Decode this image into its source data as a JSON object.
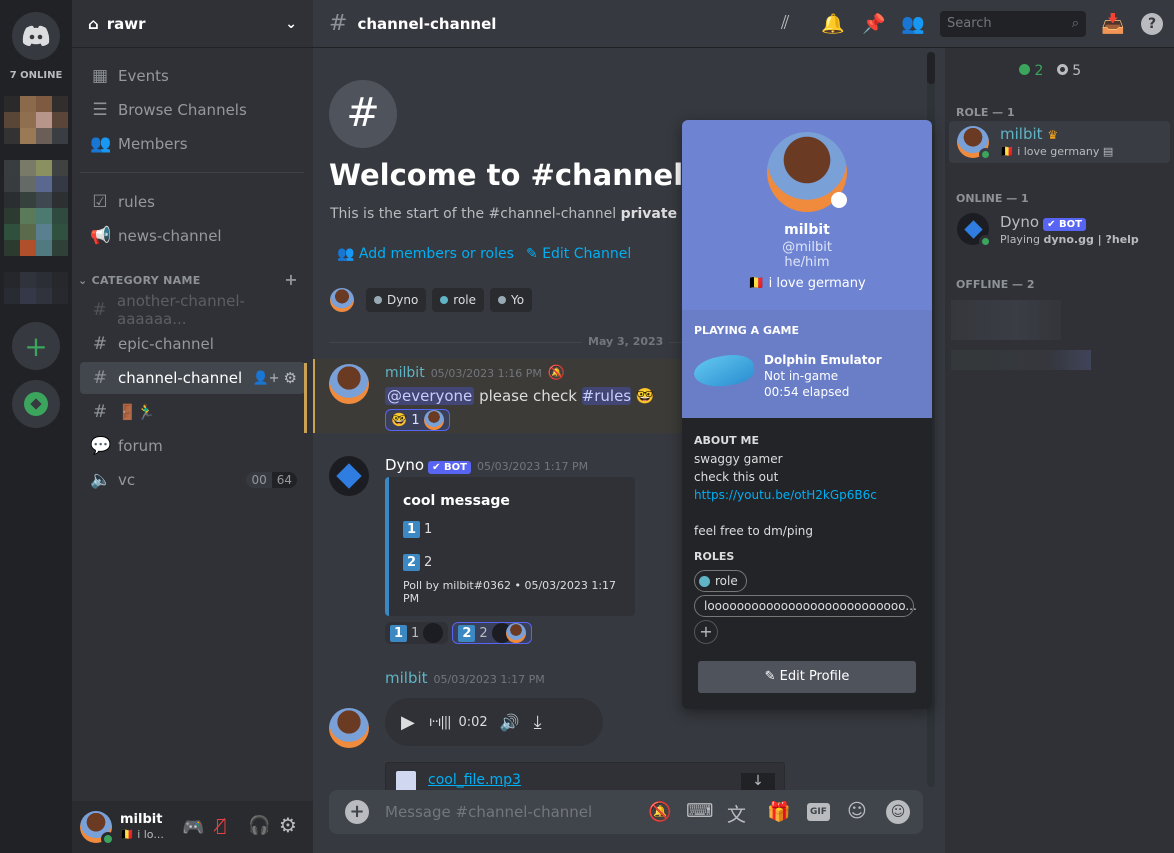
{
  "server_rail": {
    "online_label": "7 ONLINE"
  },
  "sidebar": {
    "server_name": "rawr",
    "top_items": [
      {
        "label": "Events",
        "icon": "calendar-icon"
      },
      {
        "label": "Browse Channels",
        "icon": "browse-icon"
      },
      {
        "label": "Members",
        "icon": "members-icon"
      }
    ],
    "channels": [
      {
        "label": "rules",
        "icon": "rules-icon"
      },
      {
        "label": "news-channel",
        "icon": "megaphone-icon"
      }
    ],
    "category": "CATEGORY NAME",
    "category_channels": [
      {
        "label": "another-channel-aaaaaa...",
        "icon": "locked-hash-icon",
        "state": "muted"
      },
      {
        "label": "epic-channel",
        "icon": "locked-hash-icon"
      },
      {
        "label": "channel-channel",
        "icon": "locked-hash-icon",
        "state": "active"
      },
      {
        "label": "🚪🏃‍♂",
        "icon": "locked-hash-icon"
      },
      {
        "label": "forum",
        "icon": "forum-icon"
      },
      {
        "label": "vc",
        "icon": "voice-icon",
        "badge_left": "00",
        "badge_right": "64"
      }
    ]
  },
  "user_panel": {
    "name": "milbit",
    "status": "🇧🇪 i lo..."
  },
  "header": {
    "channel": "channel-channel",
    "search_placeholder": "Search"
  },
  "welcome": {
    "title": "Welcome to #channel-cha",
    "desc_pre": "This is the start of the #channel-channel ",
    "desc_bold": "private",
    "desc_post": " chan",
    "add_members": "Add members or roles",
    "edit_channel": "Edit Channel",
    "chips": [
      {
        "label": "Dyno",
        "color": "#99aab5"
      },
      {
        "label": "role",
        "color": "#5fb4c6"
      },
      {
        "label": "Yo",
        "color": "#99aab5"
      }
    ]
  },
  "divider_date": "May 3, 2023",
  "messages": [
    {
      "author": "milbit",
      "time": "05/03/2023 1:16 PM",
      "mention": "@everyone",
      "text": " please check ",
      "channel_link": "#rules",
      "emoji": "🤓",
      "reaction": {
        "emoji": "🤓",
        "count": "1"
      }
    },
    {
      "author": "Dyno",
      "bot": "BOT",
      "time": "05/03/2023 1:17 PM",
      "embed": {
        "title": "cool message",
        "opt1": "1",
        "opt1_label": "1",
        "opt2": "2",
        "opt2_label": "2",
        "footer": "Poll by milbit#0362 • 05/03/2023 1:17 PM"
      },
      "reactions": [
        {
          "n": "1",
          "count": "1"
        },
        {
          "n": "2",
          "count": "2"
        }
      ]
    },
    {
      "author": "milbit",
      "time": "05/03/2023 1:17 PM",
      "audio_time": "0:02",
      "file": "cool_file.mp3"
    }
  ],
  "composer": {
    "placeholder": "Message #channel-channel",
    "gif": "GIF"
  },
  "members": {
    "online_count": "2",
    "offline_count": "5",
    "groups": [
      {
        "label": "ROLE — 1"
      },
      {
        "label": "ONLINE — 1"
      },
      {
        "label": "OFFLINE — 2"
      }
    ],
    "milbit": {
      "name": "milbit",
      "status": "🇧🇪 i love germany"
    },
    "dyno": {
      "name": "Dyno",
      "bot": "BOT",
      "status_pre": "Playing ",
      "status_bold": "dyno.gg | ?help"
    }
  },
  "profile": {
    "name": "milbit",
    "handle": "@milbit",
    "pronouns": "he/him",
    "status": "🇧🇪 i love germany",
    "activity_header": "PLAYING A GAME",
    "game": "Dolphin Emulator",
    "game_state": "Not in-game",
    "elapsed": "00:54 elapsed",
    "about_header": "ABOUT ME",
    "about_lines": [
      "swaggy gamer",
      "check this out"
    ],
    "link": "https://youtu.be/otH2kGp6B6c",
    "about_last": "feel free to dm/ping",
    "roles_header": "ROLES",
    "roles": [
      {
        "label": "role",
        "color": "#5fb4c6"
      },
      {
        "label": "looooooooooooooooooooooooooo...",
        "color": "#c4c9ce"
      }
    ],
    "edit_button": "Edit Profile",
    "banner_color": "#6e84d3"
  }
}
